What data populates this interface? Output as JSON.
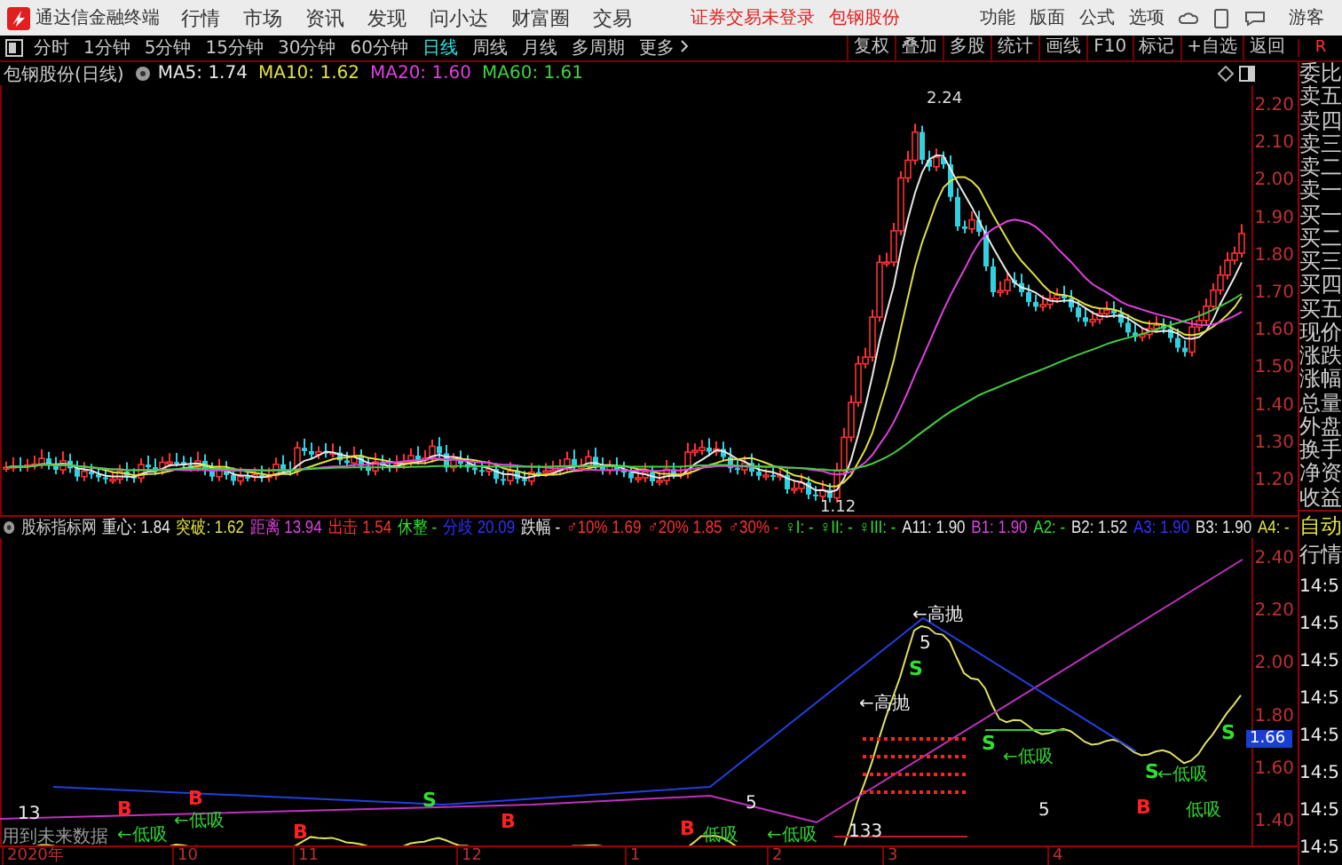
{
  "title_bar": {
    "app_name": "通达信金融终端",
    "menu": [
      "行情",
      "市场",
      "资讯",
      "发现",
      "问小达",
      "财富圈",
      "交易"
    ],
    "notices": [
      "证券交易未登录",
      "包钢股份"
    ],
    "actions": [
      "功能",
      "版面",
      "公式",
      "选项"
    ],
    "user": "游客"
  },
  "period_tabs": [
    {
      "label": "分时",
      "selected": false
    },
    {
      "label": "1分钟",
      "selected": false
    },
    {
      "label": "5分钟",
      "selected": false
    },
    {
      "label": "15分钟",
      "selected": false
    },
    {
      "label": "30分钟",
      "selected": false
    },
    {
      "label": "60分钟",
      "selected": false
    },
    {
      "label": "日线",
      "selected": true
    },
    {
      "label": "周线",
      "selected": false
    },
    {
      "label": "月线",
      "selected": false
    },
    {
      "label": "多周期",
      "selected": false
    }
  ],
  "more_tab": "更多",
  "tools": [
    "复权",
    "叠加",
    "多股",
    "统计",
    "画线",
    "F10",
    "标记",
    "+自选",
    "返回"
  ],
  "corner_mark": "R",
  "price_chart": {
    "title": "包钢股份(日线)",
    "ma": [
      {
        "label": "MA5: 1.74",
        "color": "#e8e8e8"
      },
      {
        "label": "MA10: 1.62",
        "color": "#e0e040"
      },
      {
        "label": "MA20: 1.60",
        "color": "#e040e0"
      },
      {
        "label": "MA60: 1.61",
        "color": "#40d040"
      }
    ],
    "y_labels": [
      "2.20",
      "2.10",
      "2.00",
      "1.90",
      "1.80",
      "1.70",
      "1.60",
      "1.50",
      "1.40",
      "1.30",
      "1.20"
    ],
    "high_label": "2.24",
    "low_label": "1.12"
  },
  "indicator": {
    "name": "股标指标网",
    "items": [
      {
        "label": "重心: 1.84",
        "color": "#e8e8e8"
      },
      {
        "label": "突破: 1.62",
        "color": "#e0e040"
      },
      {
        "label": "距离 13.94",
        "color": "#e040e0"
      },
      {
        "label": "出击 1.54",
        "color": "#ff3030"
      },
      {
        "label": "休整 -",
        "color": "#30e030"
      },
      {
        "label": "分歧 20.09",
        "color": "#3030ff"
      },
      {
        "label": "跌幅 -",
        "color": "#e8e8e8"
      },
      {
        "label": "♂10% 1.69",
        "color": "#ff3030"
      },
      {
        "label": "♂20% 1.85",
        "color": "#ff3030"
      },
      {
        "label": "♂30% -",
        "color": "#ff3030"
      },
      {
        "label": "♀I: -",
        "color": "#30e030"
      },
      {
        "label": "♀II: -",
        "color": "#30e030"
      },
      {
        "label": "♀III: -",
        "color": "#30e030"
      },
      {
        "label": "A11: 1.90",
        "color": "#e8e8e8"
      },
      {
        "label": "B1: 1.90",
        "color": "#e040e0"
      },
      {
        "label": "A2: -",
        "color": "#30e030"
      },
      {
        "label": "B2: 1.52",
        "color": "#e8e8e8"
      },
      {
        "label": "A3: 1.90",
        "color": "#3030ff"
      },
      {
        "label": "B3: 1.90",
        "color": "#e8e8e8"
      },
      {
        "label": "A4: -",
        "color": "#e0e040"
      }
    ],
    "y_labels": [
      "2.40",
      "2.20",
      "2.00",
      "1.80",
      "1.60",
      "1.40"
    ],
    "current_value": "1.66",
    "marks": [
      {
        "kind": "count",
        "text": "13"
      },
      {
        "kind": "buy",
        "text": "B"
      },
      {
        "kind": "low",
        "text": "←低吸"
      },
      {
        "kind": "low",
        "text": "←低吸"
      },
      {
        "kind": "buy",
        "text": "B"
      },
      {
        "kind": "buy",
        "text": "B"
      },
      {
        "kind": "sell",
        "text": "S"
      },
      {
        "kind": "buy",
        "text": "B"
      },
      {
        "kind": "buy",
        "text": "B"
      },
      {
        "kind": "low",
        "text": "低吸"
      },
      {
        "kind": "count",
        "text": "5"
      },
      {
        "kind": "low",
        "text": "←低吸"
      },
      {
        "kind": "count",
        "text": "133"
      },
      {
        "kind": "high",
        "text": "←高抛"
      },
      {
        "kind": "high",
        "text": "←高抛"
      },
      {
        "kind": "count",
        "text": "5"
      },
      {
        "kind": "sell",
        "text": "S"
      },
      {
        "kind": "sell",
        "text": "S"
      },
      {
        "kind": "low",
        "text": "←低吸"
      },
      {
        "kind": "count",
        "text": "5"
      },
      {
        "kind": "buy",
        "text": "B"
      },
      {
        "kind": "sell",
        "text": "S"
      },
      {
        "kind": "low",
        "text": "←低吸"
      },
      {
        "kind": "low",
        "text": "低吸"
      },
      {
        "kind": "sell",
        "text": "S"
      }
    ],
    "note": "用到未来数据"
  },
  "x_axis": [
    "2020年",
    "10",
    "11",
    "12",
    "1",
    "2",
    "3",
    "4"
  ],
  "quote_panel": {
    "labels": [
      "委比",
      "卖五",
      "卖四",
      "卖三",
      "卖二",
      "卖一",
      "买一",
      "买二",
      "买三",
      "买四",
      "买五",
      "现价",
      "涨跌",
      "涨幅",
      "总量",
      "外盘",
      "换手",
      "净资",
      "收益"
    ],
    "lower_labels": [
      "自动",
      "行情"
    ],
    "times": [
      "14:5",
      "14:5",
      "14:5",
      "14:5",
      "14:5",
      "14:5",
      "14:5",
      "14:5"
    ]
  }
}
